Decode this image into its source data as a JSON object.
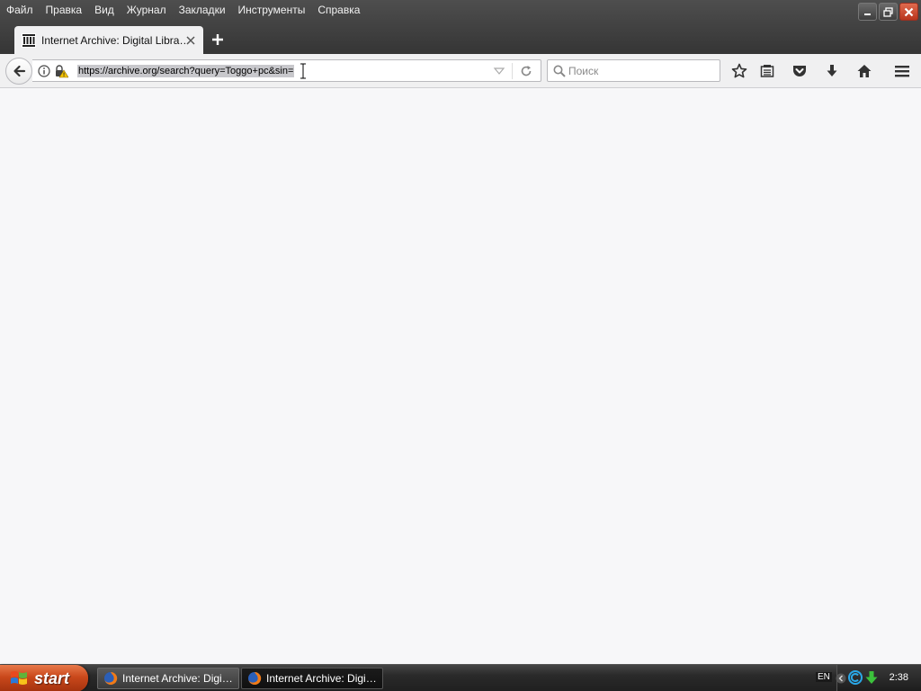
{
  "menu": {
    "items": [
      "Файл",
      "Правка",
      "Вид",
      "Журнал",
      "Закладки",
      "Инструменты",
      "Справка"
    ]
  },
  "tab": {
    "title": "Internet Archive: Digital Libra…",
    "favicon": "internet-archive-icon"
  },
  "navbar": {
    "url": "https://archive.org/search?query=Toggo+pc&sin=",
    "search_placeholder": "Поиск",
    "search_value": ""
  },
  "taskbar": {
    "start_label": "start",
    "tasks": [
      {
        "label": "Internet Archive: Digi…",
        "state": "inactive"
      },
      {
        "label": "Internet Archive: Digi…",
        "state": "active"
      }
    ],
    "language": "EN",
    "clock": "2:38"
  },
  "colors": {
    "titlebar": "#3d3d3d",
    "toolbar": "#f0f0f1",
    "content_bg": "#f7f7f9",
    "start_button": "#c9481b"
  }
}
